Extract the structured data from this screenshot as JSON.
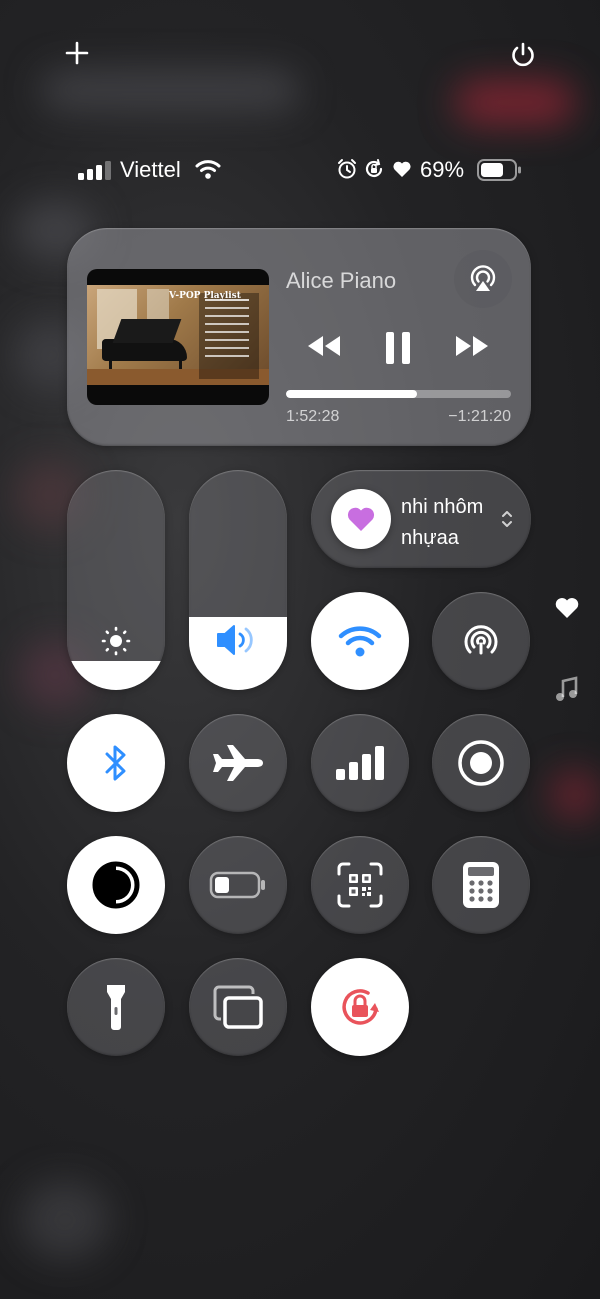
{
  "status_bar": {
    "carrier": "Viettel",
    "battery_percent": "69%"
  },
  "media": {
    "title": "Alice Piano",
    "artwork_caption": "V-POP Playlist",
    "elapsed": "1:52:28",
    "remaining": "−1:21:20",
    "progress": 0.58
  },
  "focus": {
    "name": "nhi nhôm nhựaa"
  },
  "sliders": {
    "brightness": 0.13,
    "volume": 0.33
  },
  "accent": {
    "wifi_blue": "#2f8fff",
    "focus_pink": "#c86ee0",
    "lock_red": "#e9535b"
  }
}
